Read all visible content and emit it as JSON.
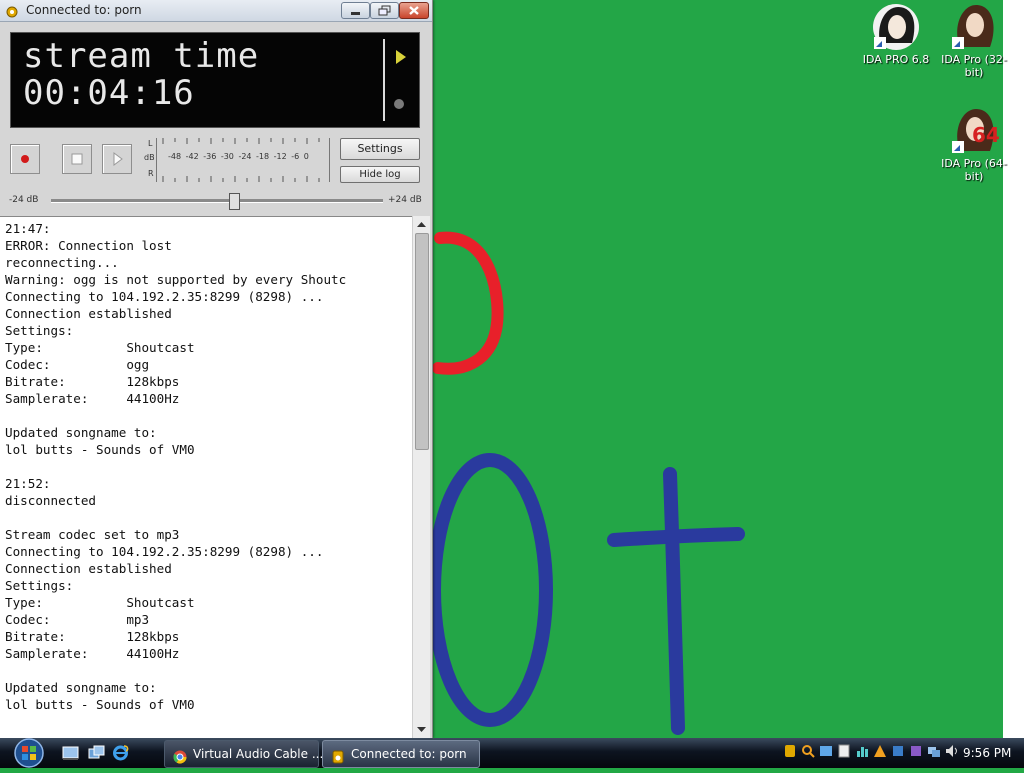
{
  "window": {
    "title": "Connected to: porn",
    "controls": {
      "minimize": "minimize",
      "maximize": "maximize",
      "close": "close"
    }
  },
  "display": {
    "line1": "stream time",
    "line2": "00:04:16"
  },
  "meter": {
    "left_label": "L",
    "db_label": "dB",
    "right_label": "R",
    "scale": "-48 -42 -36 -30 -24 -18 -12 -6 0"
  },
  "buttons": {
    "settings": "Settings",
    "hide_log": "Hide log"
  },
  "slider": {
    "min_label": "-24 dB",
    "max_label": "+24 dB",
    "value_fraction": 0.55
  },
  "log": {
    "lines": [
      "21:47:",
      "ERROR: Connection lost",
      "reconnecting...",
      "Warning: ogg is not supported by every Shoutc",
      "Connecting to 104.192.2.35:8299 (8298) ...",
      "Connection established",
      "Settings:",
      "Type:           Shoutcast",
      "Codec:          ogg",
      "Bitrate:        128kbps",
      "Samplerate:     44100Hz",
      "",
      "Updated songname to:",
      "lol butts - Sounds of VM0",
      "",
      "21:52:",
      "disconnected",
      "",
      "Stream codec set to mp3",
      "Connecting to 104.192.2.35:8299 (8298) ...",
      "Connection established",
      "Settings:",
      "Type:           Shoutcast",
      "Codec:          mp3",
      "Bitrate:        128kbps",
      "Samplerate:     44100Hz",
      "",
      "Updated songname to:",
      "lol butts - Sounds of VM0"
    ]
  },
  "desktop_icons": [
    {
      "label": "IDA PRO 6.8"
    },
    {
      "label": "IDA Pro (32-bit)"
    },
    {
      "label": "IDA Pro (64-bit)",
      "badge": "64"
    }
  ],
  "taskbar": {
    "tasks": [
      {
        "label": "Virtual Audio Cable ..."
      },
      {
        "label": "Connected to: porn"
      }
    ],
    "clock": "9:56 PM"
  },
  "colors": {
    "desktop_green": "#23a647",
    "stroke_red": "#e8202a",
    "stroke_blue": "#2a3a9e"
  }
}
